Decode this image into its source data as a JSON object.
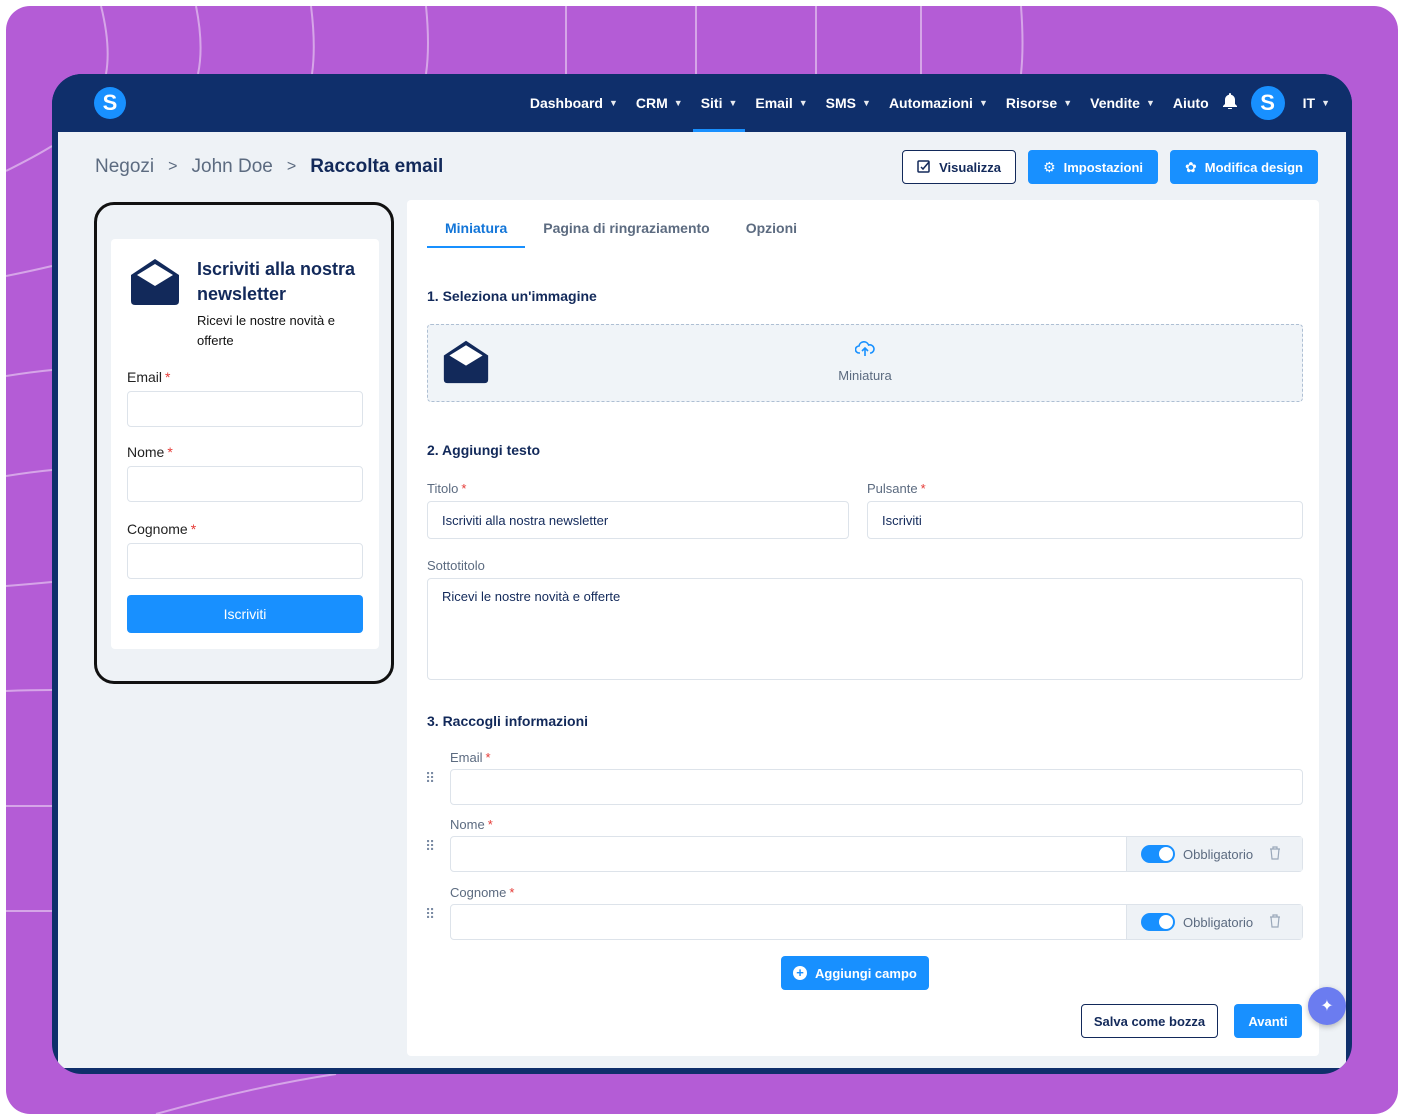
{
  "nav": {
    "items": [
      {
        "label": "Dashboard",
        "dropdown": true,
        "active": false
      },
      {
        "label": "CRM",
        "dropdown": true,
        "active": false
      },
      {
        "label": "Siti",
        "dropdown": true,
        "active": true
      },
      {
        "label": "Email",
        "dropdown": true,
        "active": false
      },
      {
        "label": "SMS",
        "dropdown": true,
        "active": false
      },
      {
        "label": "Automazioni",
        "dropdown": true,
        "active": false
      },
      {
        "label": "Risorse",
        "dropdown": true,
        "active": false
      },
      {
        "label": "Vendite",
        "dropdown": true,
        "active": false
      },
      {
        "label": "Aiuto",
        "dropdown": false,
        "active": false
      }
    ],
    "language": "IT",
    "logo_letter": "S",
    "avatar_letter": "S"
  },
  "breadcrumb": {
    "items": [
      "Negozi",
      "John Doe"
    ],
    "current": "Raccolta email"
  },
  "header_buttons": {
    "preview": "Visualizza",
    "settings": "Impostazioni",
    "design": "Modifica design"
  },
  "preview": {
    "title": "Iscriviti alla nostra newsletter",
    "subtitle": "Ricevi le nostre novità e offerte",
    "fields": [
      "Email",
      "Nome",
      "Cognome"
    ],
    "button": "Iscriviti"
  },
  "tabs": [
    "Miniatura",
    "Pagina di ringraziamento",
    "Opzioni"
  ],
  "sections": {
    "image": "1. Seleziona un'immagine",
    "text": "2. Aggiungi testo",
    "info": "3. Raccogli informazioni"
  },
  "dropzone_label": "Miniatura",
  "form": {
    "title_label": "Titolo",
    "title_value": "Iscriviti alla nostra newsletter",
    "button_label": "Pulsante",
    "button_value": "Iscriviti",
    "subtitle_label": "Sottotitolo",
    "subtitle_value": "Ricevi le nostre novità e offerte"
  },
  "collect_fields": [
    {
      "label": "Email",
      "required_toggle": false
    },
    {
      "label": "Nome",
      "required_toggle": true
    },
    {
      "label": "Cognome",
      "required_toggle": true
    }
  ],
  "required_label": "Obbligatorio",
  "add_field": "Aggiungi campo",
  "save_draft": "Salva come bozza",
  "next": "Avanti",
  "colors": {
    "primary": "#1890ff",
    "navy": "#0f2f6b",
    "background": "#b45cd6"
  }
}
